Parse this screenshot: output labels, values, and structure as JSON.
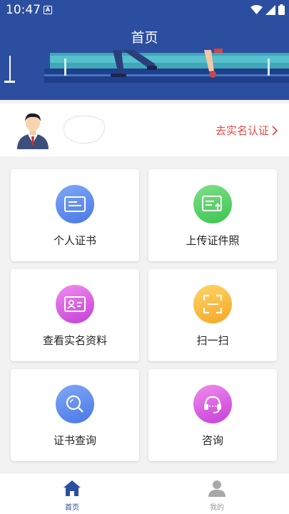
{
  "status_bar": {
    "time": "10:47",
    "notification_letter": "A"
  },
  "header": {
    "title": "首页"
  },
  "profile": {
    "verify_label": "去实名认证"
  },
  "cards": [
    {
      "label": "个人证书",
      "icon": "certificate-icon",
      "color_from": "#7fa8f7",
      "color_to": "#4a78e6"
    },
    {
      "label": "上传证件照",
      "icon": "upload-document-icon",
      "color_from": "#7fe08a",
      "color_to": "#3cc44f"
    },
    {
      "label": "查看实名资料",
      "icon": "id-card-icon",
      "color_from": "#f28cf0",
      "color_to": "#c43fd6"
    },
    {
      "label": "扫一扫",
      "icon": "scan-icon",
      "color_from": "#ffd56a",
      "color_to": "#f5a623"
    },
    {
      "label": "证书查询",
      "icon": "search-icon",
      "color_from": "#7fa8f7",
      "color_to": "#4a78e6"
    },
    {
      "label": "咨询",
      "icon": "headset-icon",
      "color_from": "#f28cf0",
      "color_to": "#c43fd6"
    }
  ],
  "bottom_nav": [
    {
      "label": "首页",
      "icon": "home-icon",
      "active": true,
      "color": "#2c4ea0"
    },
    {
      "label": "我的",
      "icon": "user-icon",
      "active": false,
      "color": "#999999"
    }
  ]
}
